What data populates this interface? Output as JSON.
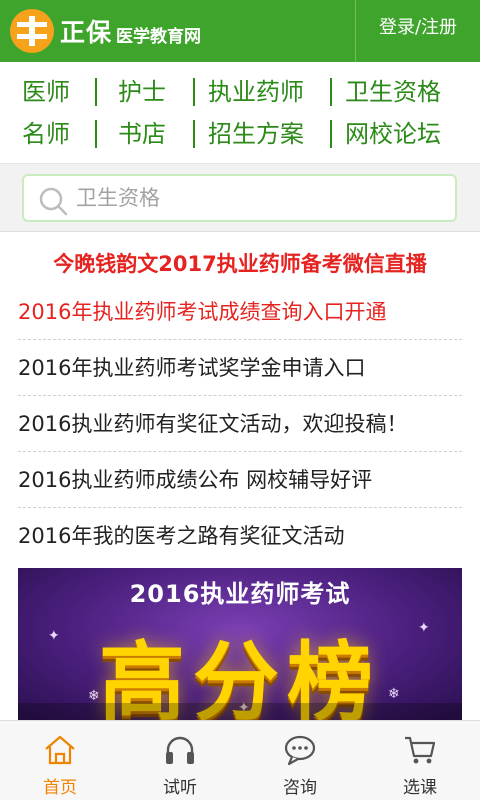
{
  "header": {
    "logo_main": "正保",
    "logo_sub": "医学教育网",
    "login_label": "登录/注册"
  },
  "nav": {
    "row1": [
      "医师",
      "护士",
      "执业药师",
      "卫生资格"
    ],
    "row2": [
      "名师",
      "书店",
      "招生方案",
      "网校论坛"
    ]
  },
  "search": {
    "placeholder": "卫生资格",
    "icon": "search-icon"
  },
  "headline": "今晚钱韵文2017执业药师备考微信直播",
  "news": [
    {
      "text": "2016年执业药师考试成绩查询入口开通",
      "highlight": true
    },
    {
      "text": "2016年执业药师考试奖学金申请入口",
      "highlight": false
    },
    {
      "text": "2016执业药师有奖征文活动，欢迎投稿！",
      "highlight": false
    },
    {
      "text": "2016执业药师成绩公布 网校辅导好评",
      "highlight": false
    },
    {
      "text": "2016年我的医考之路有奖征文活动",
      "highlight": false
    }
  ],
  "banner": {
    "title": "2016执业药师考试",
    "big_text": "高分榜"
  },
  "tabbar": {
    "tabs": [
      {
        "label": "首页",
        "icon": "home-icon",
        "active": true
      },
      {
        "label": "试听",
        "icon": "headphones-icon",
        "active": false
      },
      {
        "label": "咨询",
        "icon": "chat-bubble-icon",
        "active": false
      },
      {
        "label": "选课",
        "icon": "cart-icon",
        "active": false
      }
    ]
  },
  "colors": {
    "brand_green": "#3fa42c",
    "nav_green": "#2b8a18",
    "headline_red": "#e52421",
    "tab_active": "#f08300",
    "logo_orange": "#f7a21b"
  }
}
